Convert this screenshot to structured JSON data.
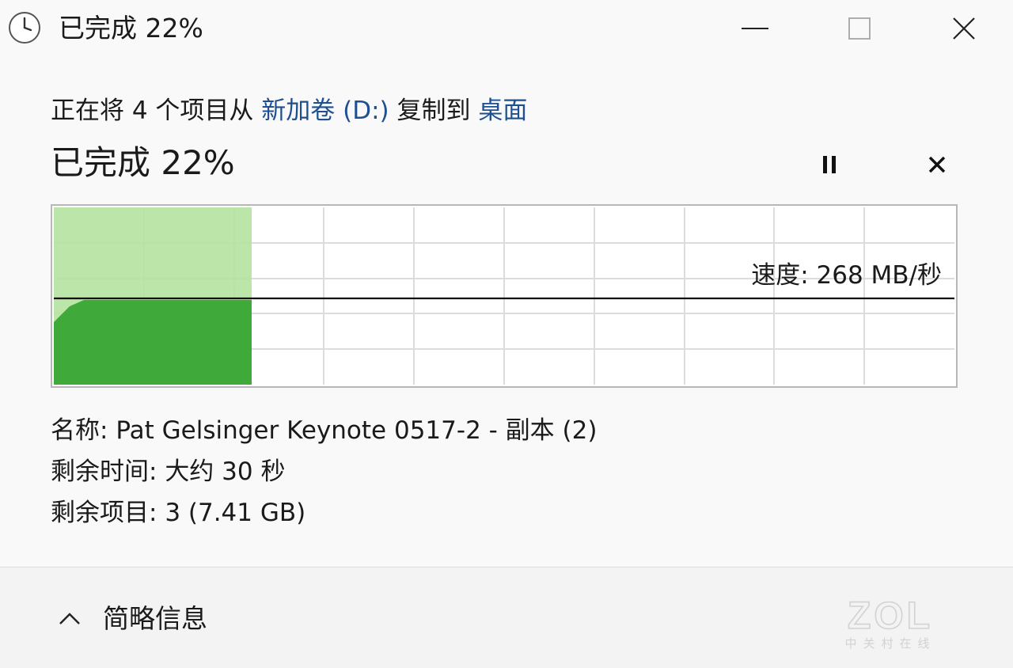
{
  "window": {
    "title": "已完成 22%"
  },
  "transfer": {
    "prefix": "正在将 4 个项目从 ",
    "source": "新加卷 (D:)",
    "middle": " 复制到 ",
    "destination": "桌面",
    "percent_text": "已完成 22%",
    "progress_fraction": 0.22,
    "speed_text": "速度: 268 MB/秒"
  },
  "details": {
    "name_label": "名称: ",
    "name_value": "Pat Gelsinger Keynote 0517-2 - 副本 (2)",
    "time_label": "剩余时间: ",
    "time_value": "大约 30 秒",
    "items_label": "剩余项目: ",
    "items_value": "3 (7.41 GB)"
  },
  "footer": {
    "collapse_label": "简略信息"
  },
  "watermark": {
    "text": "ZOL",
    "subtext": "中关村在线"
  },
  "icons": {
    "title": "clock-icon",
    "minimize": "minimize-icon",
    "maximize": "maximize-icon",
    "close": "close-icon",
    "pause": "pause-icon",
    "cancel": "cancel-icon",
    "collapse": "chevron-up-icon"
  },
  "colors": {
    "progress_light": "#b5e3a0",
    "progress_dark": "#3fa93a",
    "link": "#1d4f91"
  }
}
